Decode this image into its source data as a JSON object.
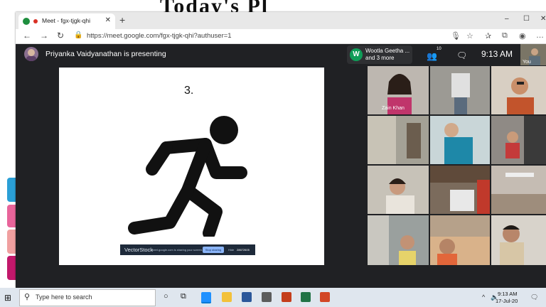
{
  "background": {
    "doodle_text": "Today's Pl"
  },
  "browser": {
    "tab_title": "Meet - fgx-tjgk-qhi",
    "new_tab": "+",
    "url": "https://meet.google.com/fgx-tjgk-qhi?authuser=1",
    "window_controls": {
      "minimize": "–",
      "maximize": "☐",
      "close": "✕"
    }
  },
  "meet": {
    "presenting_text": "Priyanka Vaidyanathan is presenting",
    "participants": {
      "first": "Wootla Geetha ...",
      "more": "and 3 more",
      "avatar_letter": "W"
    },
    "people_count": "10",
    "time": "9:13 AM",
    "self_label": "You",
    "slide": {
      "number": "3."
    },
    "vectorstock": {
      "brand": "VectorStock",
      "sharing_msg": "meet.google.com is sharing your screen.",
      "stop_button": "Stop sharing",
      "hide": "Hide",
      "image_id": "28672605"
    },
    "tiles": [
      {
        "name": "Zain Khan",
        "bg": "#b9b4ae"
      },
      {
        "name": "",
        "bg": "#9c9a94"
      },
      {
        "name": "",
        "bg": "#d8cfc3"
      },
      {
        "name": "",
        "bg": "#a4a196"
      },
      {
        "name": "",
        "bg": "#c9d6d8"
      },
      {
        "name": "",
        "bg": "#8f8a85"
      },
      {
        "name": "",
        "bg": "#c7c2b8"
      },
      {
        "name": "",
        "bg": "#7b6b5c"
      },
      {
        "name": "",
        "bg": "#c5bcb3"
      },
      {
        "name": "",
        "bg": "#9aa09e"
      },
      {
        "name": "",
        "bg": "#b6a18a"
      },
      {
        "name": "",
        "bg": "#d8d3cb"
      }
    ]
  },
  "taskbar": {
    "search_placeholder": "Type here to search",
    "clock_time": "9:13 AM",
    "clock_date": "17-Jul-20"
  },
  "colors": {
    "meet_bg": "#202124",
    "accent_green": "#0f9d58",
    "taskbar_bg": "#dfe6ee"
  }
}
